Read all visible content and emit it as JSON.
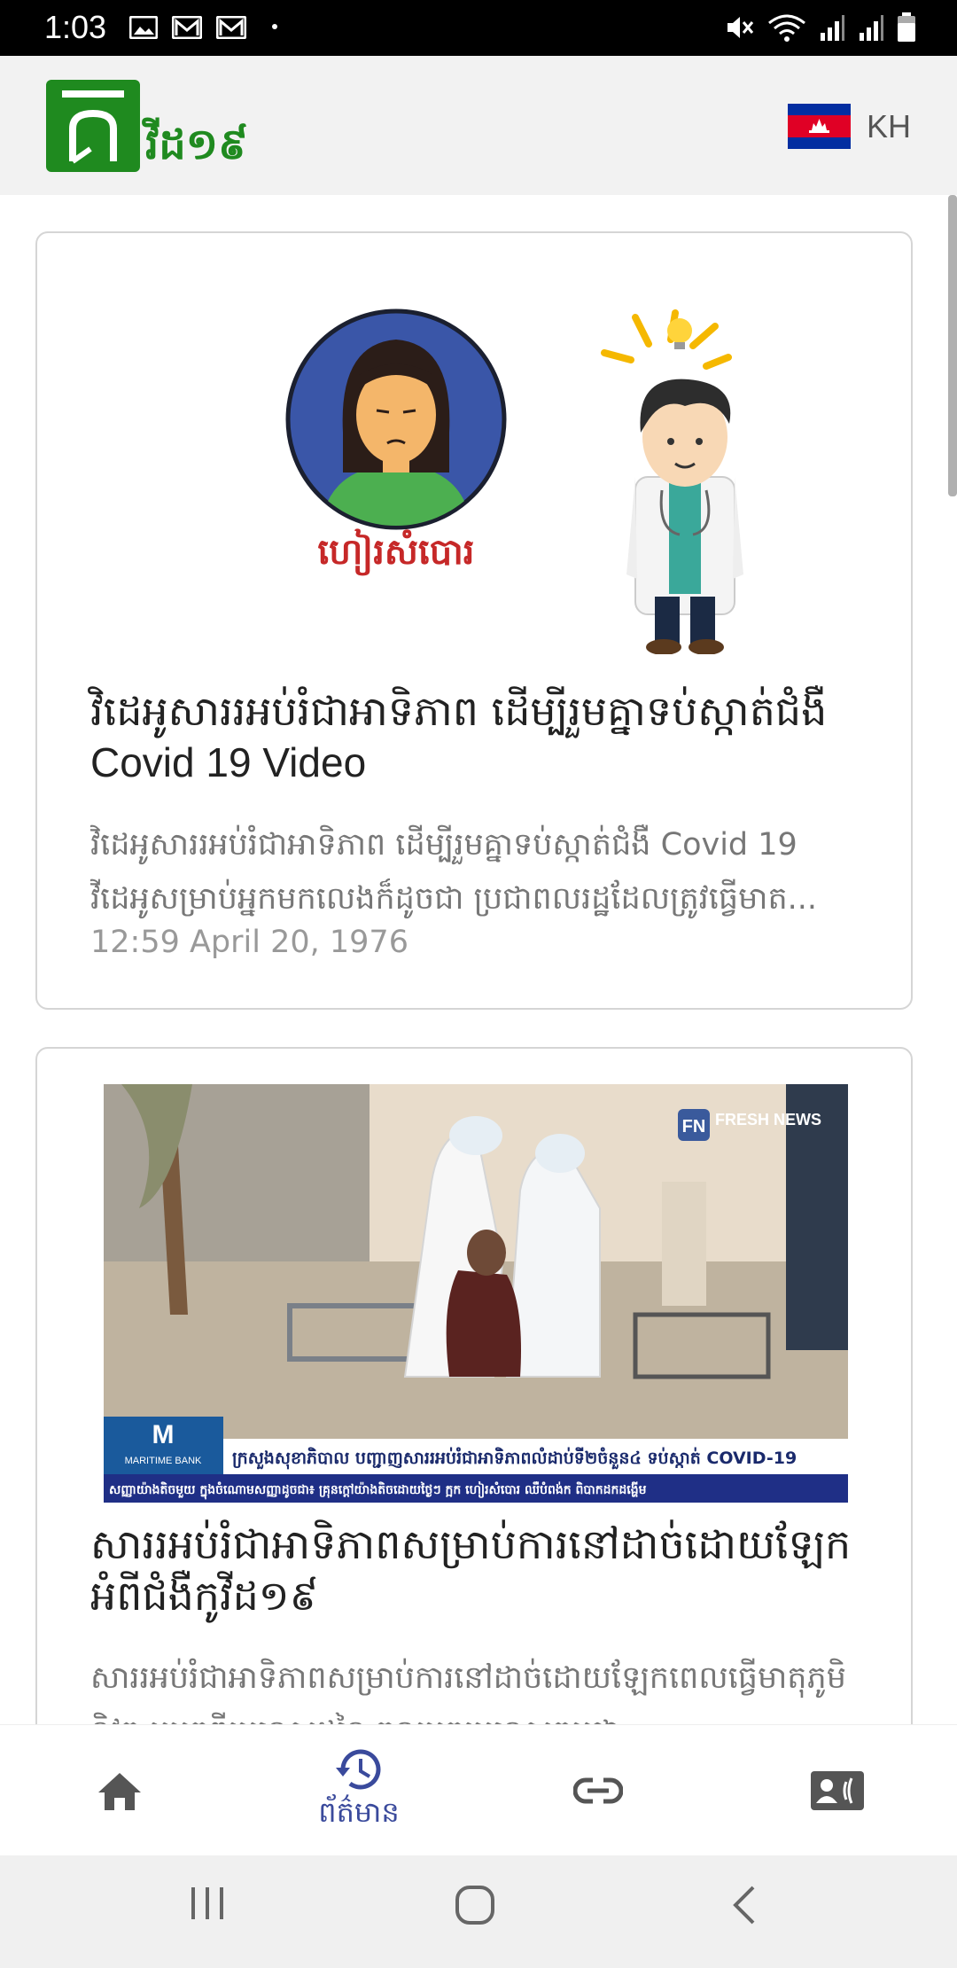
{
  "status_bar": {
    "time": "1:03",
    "left_icons": [
      "image-icon",
      "mail-icon",
      "mail-icon",
      "dot-icon"
    ],
    "right_icons": [
      "mute-icon",
      "wifi-icon",
      "signal-icon",
      "signal-icon",
      "battery-icon"
    ]
  },
  "app_bar": {
    "logo_text": "វីដ១៩",
    "language": "KH",
    "colors": {
      "brand": "#1f8a1f",
      "background": "#f2f2f2"
    }
  },
  "articles": [
    {
      "title_line1": "វិដេអូសាររអប់រំជាអាទិភាព ដើម្បីរួមគ្នាទប់ស្កាត់ជំងឺ",
      "title_line2": "Covid 19 Video",
      "desc_line1": "វិដេអូសាររអប់រំជាអាទិភាព ដើម្បីរួមគ្នាទប់ស្កាត់ជំងឺ Covid 19",
      "desc_line2": "វីដេអូសម្រាប់អ្នកមកលេងក៏ដូចជា ប្រជាពលរដ្ឋដែលត្រូវធ្វើមាត...",
      "date": "12:59 April 20, 1976",
      "image": {
        "caption": "ហៀរសំបោរ",
        "kind": "cartoon-illustration"
      }
    },
    {
      "title_line1": "សាររអប់រំជាអាទិភាពសម្រាប់ការនៅដាច់ដោយឡែក",
      "title_line2": "អំពីជំងឺកូវីដ១៩",
      "desc_line1": "សាររអប់រំជាអាទិភាពសម្រាប់ការនៅដាច់ដោយឡែកពេលធ្វើមាតុភូមិ",
      "desc_line2": "និវត្ត ឬមកពីប្រទេសដទៃ ចូលមកប្រទេសកម្ពុជា",
      "image": {
        "kind": "news-photo",
        "watermark": "FRESH NEWS",
        "bank_logo": "MARITIME BANK",
        "ticker_main": "ក្រសួងសុខាភិបាល បញ្ជាញសាររអប់រំជាអាទិភាពលំដាប់ទី២ចំនួន៤ ទប់ស្កាត់ COVID-19",
        "ticker_sub": "សញ្ញាយ៉ាងតិចមួយ ក្នុងចំណោមសញ្ញាដូចជា៖ គ្រុនក្តៅយ៉ាងតិចដោយថ្ងៃៗ ក្អក ហៀរសំបោរ ឈឺបំពង់ក ពិបាកដកដង្ហើម"
      }
    }
  ],
  "bottom_nav": {
    "items": [
      {
        "icon": "home-icon",
        "label": ""
      },
      {
        "icon": "history-icon",
        "label": "ព័ត៌មាន",
        "active": true
      },
      {
        "icon": "link-icon",
        "label": ""
      },
      {
        "icon": "contact-card-icon",
        "label": ""
      }
    ],
    "active_color": "#3a4a9c",
    "inactive_color": "#555555"
  },
  "system_nav": {
    "buttons": [
      "recent-apps-icon",
      "home-circle-icon",
      "back-icon"
    ]
  }
}
